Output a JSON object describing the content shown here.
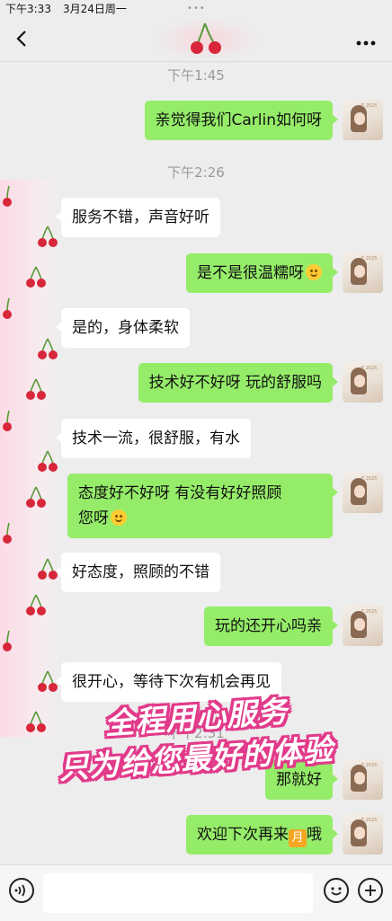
{
  "status_bar": {
    "time": "下午3:33",
    "date": "3月24日周一",
    "dots": "•••"
  },
  "messages": [
    {
      "type": "time",
      "text": "下午1:45"
    },
    {
      "type": "msg",
      "side": "right",
      "text": "亲觉得我们Carlin如何呀"
    },
    {
      "type": "time",
      "text": "下午2:26"
    },
    {
      "type": "msg",
      "side": "left",
      "text": "服务不错，声音好听"
    },
    {
      "type": "msg",
      "side": "right",
      "text": "是不是很温糯呀",
      "emoji": "smile-emoji"
    },
    {
      "type": "msg",
      "side": "left",
      "text": "是的，身体柔软"
    },
    {
      "type": "msg",
      "side": "right",
      "text": "技术好不好呀 玩的舒服吗"
    },
    {
      "type": "msg",
      "side": "left",
      "text": "技术一流，很舒服，有水"
    },
    {
      "type": "msg",
      "side": "right",
      "text_line1": "态度好不好呀 有没有好好照顾",
      "text_line2": "您呀",
      "emoji": "smile-emoji"
    },
    {
      "type": "msg",
      "side": "left",
      "text": "好态度，照顾的不错"
    },
    {
      "type": "msg",
      "side": "right",
      "text": "玩的还开心吗亲"
    },
    {
      "type": "msg",
      "side": "left",
      "text": "很开心，等待下次有机会再见"
    },
    {
      "type": "time",
      "text": "下午2:31"
    },
    {
      "type": "msg",
      "side": "right",
      "text": "那就好"
    },
    {
      "type": "msg",
      "side": "right",
      "text_before": "欢迎下次再来",
      "badge": "月",
      "text_after": "哦"
    }
  ],
  "promo": {
    "line1": "全程用心服务",
    "line2": "只为给您最好的体验"
  },
  "avatar_caption": "E 2025",
  "colors": {
    "sent_bubble": "#95ec69",
    "received_bubble": "#ffffff",
    "background": "#ededed",
    "promo_stroke": "#e23a8a"
  },
  "icons": {
    "back": "chevron-left-icon",
    "more": "more-icon",
    "voice": "voice-icon",
    "emoji": "smile-icon",
    "plus": "plus-icon"
  }
}
